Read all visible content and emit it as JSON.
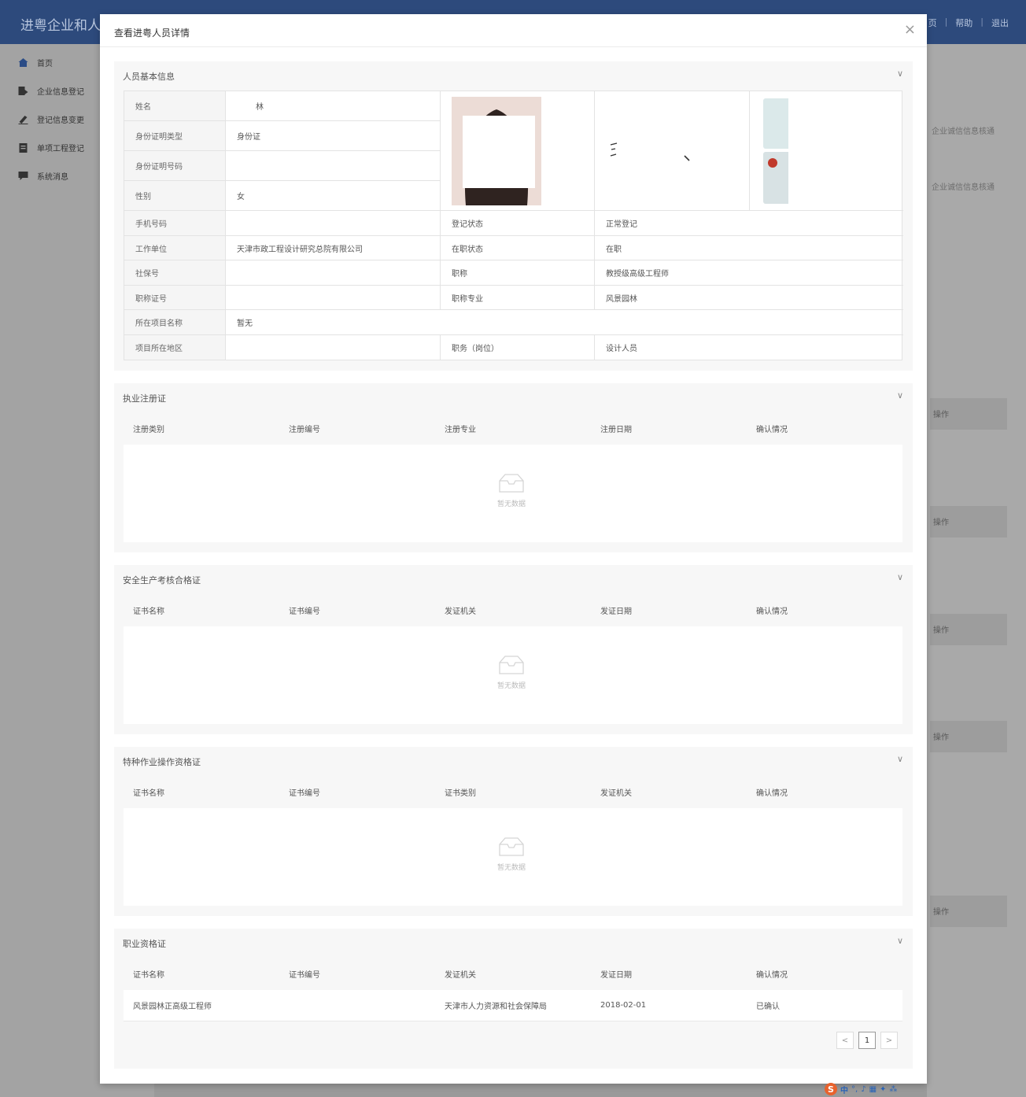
{
  "app": {
    "title": "进粤企业和人",
    "top_links": [
      "页",
      "帮助",
      "退出"
    ]
  },
  "sidebar": {
    "items": [
      {
        "label": "首页",
        "icon": "home-icon"
      },
      {
        "label": "企业信息登记",
        "icon": "enterprise-icon"
      },
      {
        "label": "登记信息变更",
        "icon": "edit-icon"
      },
      {
        "label": "单项工程登记",
        "icon": "clipboard-icon"
      },
      {
        "label": "系统消息",
        "icon": "message-icon"
      }
    ]
  },
  "background": {
    "links": [
      "企业诚信信息核通",
      "企业诚信信息核通"
    ],
    "op_label": "操作"
  },
  "modal": {
    "title": "查看进粤人员详情",
    "close": "×"
  },
  "basic": {
    "title": "人员基本信息",
    "chevron": "∨",
    "fields": {
      "name": {
        "label": "姓名",
        "value": "林"
      },
      "id_type": {
        "label": "身份证明类型",
        "value": "身份证"
      },
      "id_no": {
        "label": "身份证明号码",
        "value": ""
      },
      "gender": {
        "label": "性别",
        "value": "女"
      },
      "phone": {
        "label": "手机号码",
        "value": ""
      },
      "reg_status": {
        "label": "登记状态",
        "value": "正常登记"
      },
      "employer": {
        "label": "工作单位",
        "value": "天津市政工程设计研究总院有限公司"
      },
      "job_status": {
        "label": "在职状态",
        "value": "在职"
      },
      "social_no": {
        "label": "社保号",
        "value": ""
      },
      "title": {
        "label": "职称",
        "value": "教授级高级工程师"
      },
      "title_cert": {
        "label": "职称证号",
        "value": ""
      },
      "title_major": {
        "label": "职称专业",
        "value": "风景园林"
      },
      "project": {
        "label": "所在项目名称",
        "value": "暂无"
      },
      "project_area": {
        "label": "项目所在地区",
        "value": ""
      },
      "position": {
        "label": "职务（岗位）",
        "value": "设计人员"
      }
    }
  },
  "registration": {
    "title": "执业注册证",
    "chevron": "∨",
    "columns": [
      "注册类别",
      "注册编号",
      "注册专业",
      "注册日期",
      "确认情况"
    ],
    "empty": "暂无数据"
  },
  "safety": {
    "title": "安全生产考核合格证",
    "chevron": "∨",
    "columns": [
      "证书名称",
      "证书编号",
      "发证机关",
      "发证日期",
      "确认情况"
    ],
    "empty": "暂无数据"
  },
  "special": {
    "title": "特种作业操作资格证",
    "chevron": "∨",
    "columns": [
      "证书名称",
      "证书编号",
      "证书类别",
      "发证机关",
      "确认情况"
    ],
    "empty": "暂无数据"
  },
  "qualification": {
    "title": "职业资格证",
    "chevron": "∨",
    "columns": [
      "证书名称",
      "证书编号",
      "发证机关",
      "发证日期",
      "确认情况"
    ],
    "rows": [
      {
        "name": "风景园林正高级工程师",
        "no": "",
        "issuer": "天津市人力资源和社会保障局",
        "date": "2018-02-01",
        "status": "已确认"
      }
    ],
    "pager": {
      "prev": "<",
      "page": "1",
      "next": ">"
    }
  },
  "ime": {
    "logo": "S",
    "lang": "中"
  }
}
